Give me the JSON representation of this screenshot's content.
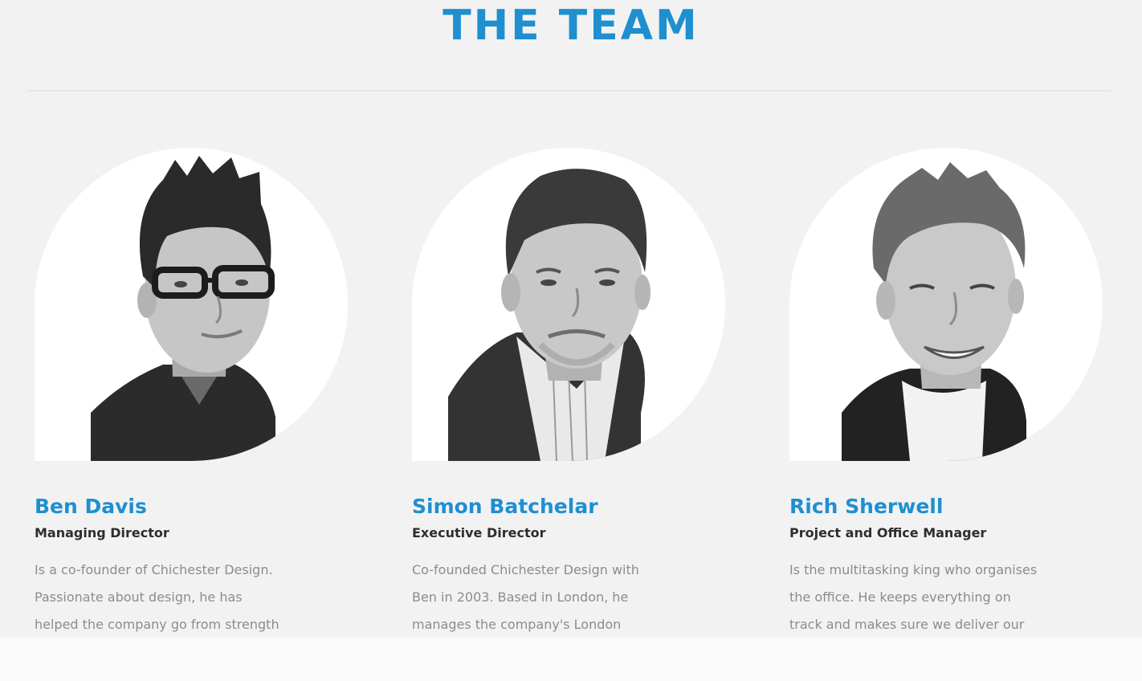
{
  "section": {
    "title": "THE TEAM"
  },
  "colors": {
    "accent": "#1f8fd0",
    "role_text": "#2e2e2e",
    "body_text": "#8c8c8c",
    "background": "#f2f2f2"
  },
  "team": [
    {
      "name": "Ben Davis",
      "role": "Managing Director",
      "bio_lines": [
        "Is a co-founder of Chichester Design.",
        "Passionate about design, he has",
        "helped the company go from strength"
      ],
      "photo": "portrait-ben-davis"
    },
    {
      "name": "Simon Batchelar",
      "role": "Executive Director",
      "bio_lines": [
        "Co-founded Chichester Design with",
        "Ben in 2003. Based in London, he",
        "manages the company's London"
      ],
      "photo": "portrait-simon-batchelar"
    },
    {
      "name": "Rich Sherwell",
      "role": "Project and Office Manager",
      "bio_lines": [
        "Is the multitasking king who organises",
        "the office. He keeps everything on",
        "track and makes sure we deliver our"
      ],
      "photo": "portrait-rich-sherwell"
    }
  ]
}
